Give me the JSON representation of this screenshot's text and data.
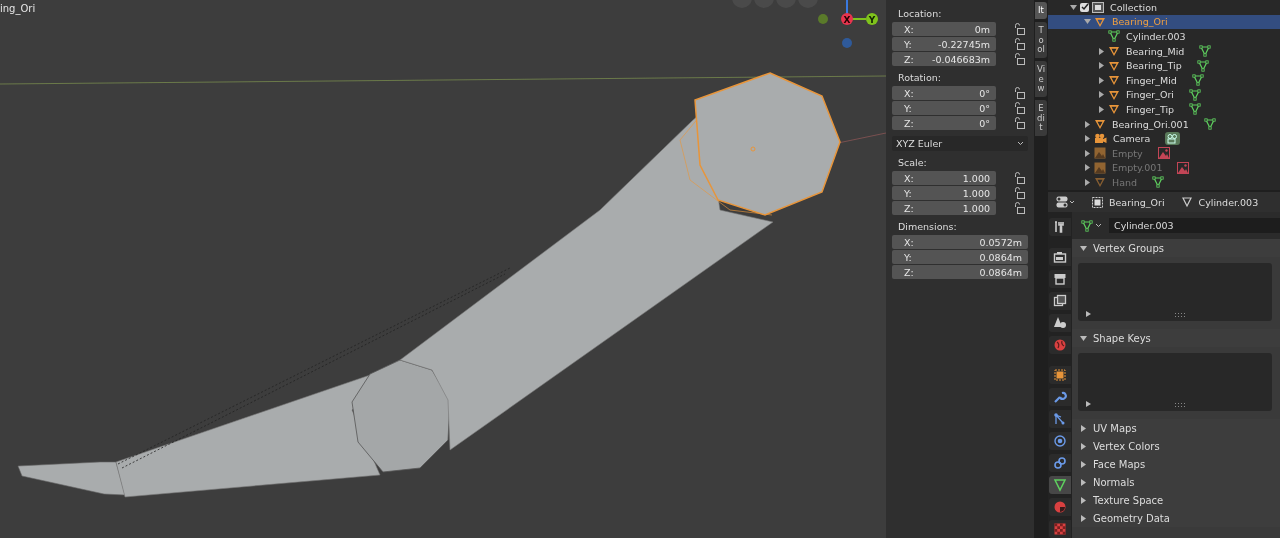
{
  "viewport": {
    "object_label": "ing_Ori",
    "gizmo": {
      "axes": [
        {
          "label": "X",
          "color": "#e8344e"
        },
        {
          "label": "Y",
          "color": "#7fc31c"
        }
      ]
    },
    "sidebar": {
      "sections": [
        {
          "title": "Location:",
          "kind": "fields",
          "fields": [
            {
              "label": "X:",
              "value": "0m",
              "locked": false
            },
            {
              "label": "Y:",
              "value": "-0.22745m",
              "locked": false
            },
            {
              "label": "Z:",
              "value": "-0.046683m",
              "locked": false
            }
          ]
        },
        {
          "title": "Rotation:",
          "kind": "fields",
          "fields": [
            {
              "label": "X:",
              "value": "0°",
              "locked": false
            },
            {
              "label": "Y:",
              "value": "0°",
              "locked": false
            },
            {
              "label": "Z:",
              "value": "0°",
              "locked": false
            }
          ]
        },
        {
          "kind": "dropdown",
          "value": "XYZ Euler"
        },
        {
          "title": "Scale:",
          "kind": "fields",
          "fields": [
            {
              "label": "X:",
              "value": "1.000",
              "locked": false
            },
            {
              "label": "Y:",
              "value": "1.000",
              "locked": false
            },
            {
              "label": "Z:",
              "value": "1.000",
              "locked": false
            }
          ]
        },
        {
          "title": "Dimensions:",
          "kind": "fields",
          "fields": [
            {
              "label": "X:",
              "value": "0.0572m"
            },
            {
              "label": "Y:",
              "value": "0.0864m"
            },
            {
              "label": "Z:",
              "value": "0.0864m"
            }
          ]
        }
      ]
    },
    "tabs": [
      {
        "label": "It",
        "selected": true
      },
      {
        "label": "Tool",
        "selected": false
      },
      {
        "label": "View",
        "selected": false
      },
      {
        "label": "Edit",
        "selected": false
      }
    ]
  },
  "outliner": {
    "items": [
      {
        "name": "Collection",
        "kind": "collection",
        "checked": true,
        "expanded": true,
        "children": [
          {
            "name": "Bearing_Ori",
            "kind": "object",
            "selected": true,
            "expanded": true,
            "disabled": false,
            "children": [
              {
                "name": "Cylinder.003",
                "kind": "mesh",
                "selected": false,
                "disabled": false
              },
              {
                "name": "Bearing_Mid",
                "kind": "object",
                "data": {
                  "kind": "mesh"
                },
                "selected": false,
                "expanded": false,
                "disabled": false
              },
              {
                "name": "Bearing_Tip",
                "kind": "object",
                "data": {
                  "kind": "mesh"
                },
                "selected": false,
                "expanded": false,
                "disabled": false
              },
              {
                "name": "Finger_Mid",
                "kind": "object",
                "data": {
                  "kind": "mesh"
                },
                "selected": false,
                "expanded": false,
                "disabled": false
              },
              {
                "name": "Finger_Ori",
                "kind": "object",
                "data": {
                  "kind": "mesh"
                },
                "selected": false,
                "expanded": false,
                "disabled": false
              },
              {
                "name": "Finger_Tip",
                "kind": "object",
                "data": {
                  "kind": "mesh"
                },
                "selected": false,
                "expanded": false,
                "disabled": false
              }
            ]
          },
          {
            "name": "Bearing_Ori.001",
            "kind": "object",
            "data": {
              "kind": "mesh"
            },
            "selected": false,
            "expanded": false,
            "disabled": false
          },
          {
            "name": "Camera",
            "kind": "camera",
            "data": {
              "kind": "camera"
            },
            "selected": false,
            "expanded": false,
            "disabled": false
          },
          {
            "name": "Empty",
            "kind": "empty",
            "data": {
              "kind": "image"
            },
            "selected": false,
            "expanded": false,
            "disabled": true
          },
          {
            "name": "Empty.001",
            "kind": "empty",
            "data": {
              "kind": "image"
            },
            "selected": false,
            "expanded": false,
            "disabled": true
          },
          {
            "name": "Hand",
            "kind": "object",
            "data": {
              "kind": "mesh"
            },
            "selected": false,
            "expanded": false,
            "disabled": true
          }
        ]
      }
    ]
  },
  "properties": {
    "breadcrumb": [
      {
        "kind": "object",
        "label": "Bearing_Ori"
      },
      {
        "kind": "mesh",
        "label": "Cylinder.003"
      }
    ],
    "data_name": "Cylinder.003",
    "tabs": [
      {
        "kind": "tool",
        "selected": false
      },
      {
        "kind": "render",
        "selected": false
      },
      {
        "kind": "output",
        "selected": false
      },
      {
        "kind": "view_layer",
        "selected": false
      },
      {
        "kind": "scene",
        "selected": false
      },
      {
        "kind": "world",
        "selected": false
      },
      {
        "kind": "object",
        "selected": false
      },
      {
        "kind": "modifiers",
        "selected": false
      },
      {
        "kind": "particles",
        "selected": false
      },
      {
        "kind": "physics",
        "selected": false
      },
      {
        "kind": "constraints",
        "selected": false
      },
      {
        "kind": "data",
        "selected": true
      },
      {
        "kind": "material",
        "selected": false
      },
      {
        "kind": "texture",
        "selected": false
      }
    ],
    "panels": [
      {
        "title": "Vertex Groups",
        "expanded": true
      },
      {
        "title": "Shape Keys",
        "expanded": true
      },
      {
        "title": "UV Maps",
        "expanded": false
      },
      {
        "title": "Vertex Colors",
        "expanded": false
      },
      {
        "title": "Face Maps",
        "expanded": false
      },
      {
        "title": "Normals",
        "expanded": false
      },
      {
        "title": "Texture Space",
        "expanded": false
      },
      {
        "title": "Geometry Data",
        "expanded": false
      }
    ]
  }
}
